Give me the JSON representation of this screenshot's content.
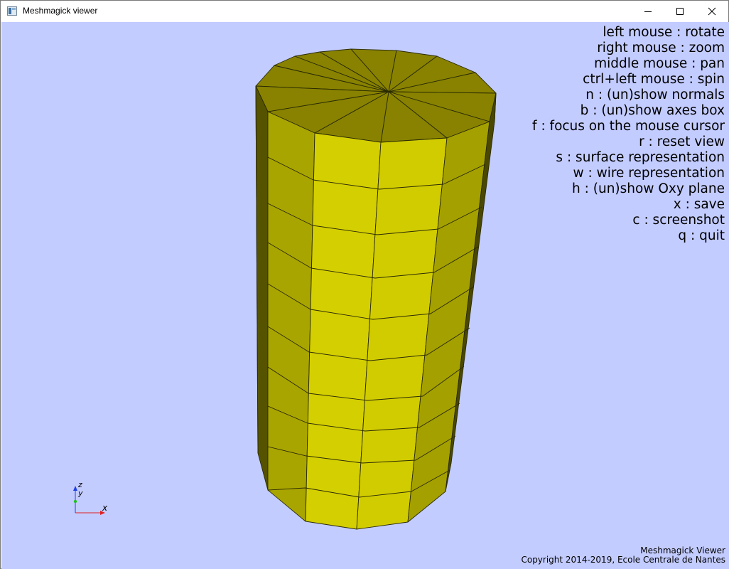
{
  "window": {
    "title": "Meshmagick viewer",
    "icon": "app-window-icon",
    "controls": [
      "minimize-icon",
      "maximize-icon",
      "close-icon"
    ]
  },
  "viewer": {
    "background": "#c3ccff",
    "object": "cylinder-mesh",
    "surface_color": "#d4cf00",
    "help_lines": [
      "left mouse : rotate",
      "right mouse : zoom",
      "middle mouse : pan",
      "ctrl+left mouse : spin",
      "n : (un)show normals",
      "b : (un)show axes box",
      "f : focus on the mouse cursor",
      "r : reset view",
      "s : surface representation",
      "w : wire representation",
      "h : (un)show Oxy plane",
      "x : save",
      "c : screenshot",
      "q : quit"
    ],
    "axes": {
      "x": "x",
      "y": "y",
      "z": "z"
    },
    "footer": {
      "line1": "Meshmagick Viewer",
      "line2": "Copyright 2014-2019, Ecole Centrale de Nantes"
    }
  }
}
